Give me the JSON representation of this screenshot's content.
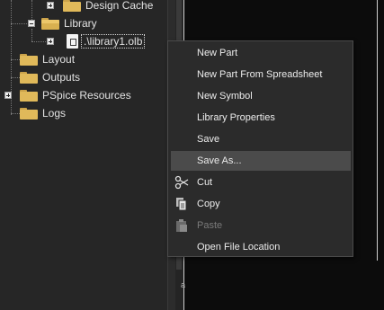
{
  "tree": {
    "items": [
      {
        "label": "Design Cache",
        "icon": "folder-icon"
      },
      {
        "label": "Library",
        "icon": "folder-open-icon"
      },
      {
        "label": ".\\library1.olb",
        "icon": "library-file-icon",
        "selected": true
      },
      {
        "label": "Layout",
        "icon": "folder-icon"
      },
      {
        "label": "Outputs",
        "icon": "folder-icon"
      },
      {
        "label": "PSpice Resources",
        "icon": "folder-icon"
      },
      {
        "label": "Logs",
        "icon": "folder-icon"
      }
    ]
  },
  "context_menu": {
    "items": [
      {
        "label": "New Part",
        "icon": "",
        "enabled": true
      },
      {
        "label": "New Part From Spreadsheet",
        "icon": "",
        "enabled": true
      },
      {
        "label": "New Symbol",
        "icon": "",
        "enabled": true
      },
      {
        "label": "Library Properties",
        "icon": "",
        "enabled": true
      },
      {
        "label": "Save",
        "icon": "",
        "enabled": true
      },
      {
        "label": "Save As...",
        "icon": "",
        "enabled": true,
        "highlighted": true
      },
      {
        "label": "Cut",
        "icon": "scissors-icon",
        "enabled": true
      },
      {
        "label": "Copy",
        "icon": "copy-icon",
        "enabled": true
      },
      {
        "label": "Paste",
        "icon": "paste-icon",
        "enabled": false
      },
      {
        "label": "Open File Location",
        "icon": "",
        "enabled": true
      }
    ]
  },
  "canvas": {
    "fragment_text": "a"
  },
  "colors": {
    "menu_bg": "#2b2b2b",
    "highlight": "#4b4b4b",
    "folder": "#e0b95a"
  }
}
